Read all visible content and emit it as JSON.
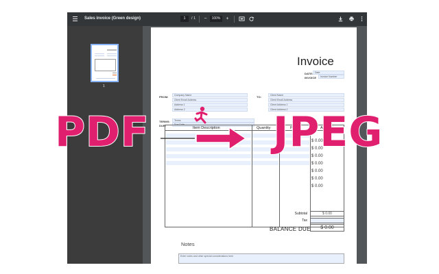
{
  "viewer": {
    "title": "Sales invoice (Green design)",
    "page_current": "1",
    "page_sep": "/",
    "page_total": "1",
    "zoom": "100%",
    "zoom_out": "−",
    "zoom_in": "+",
    "thumb_page_number": "1"
  },
  "invoice": {
    "title": "Invoice",
    "date_label": "DATE:",
    "date_value": "Date",
    "invoice_label": "INVOICE",
    "invoice_value": "Invoice Number",
    "from_label": "FROM:",
    "from_fields": [
      "Company Name",
      "Client Email Address",
      "Address 1",
      "Address 2"
    ],
    "to_label": "TO:",
    "to_fields": [
      "Client Name",
      "Client Email Address",
      "Client Address 1",
      "Client Address 2"
    ],
    "terms_label": "TERMS:",
    "terms_value": "Terms",
    "due_label": "DUE:",
    "due_value": "Due Date",
    "col_item": "Item Description",
    "col_quantity": "Quantity",
    "col_price": "Price",
    "col_amount": "Amount",
    "amounts": [
      "$ 0.00",
      "$ 0.00",
      "$ 0.00",
      "$ 0.00",
      "$ 0.00",
      "$ 0.00",
      "$ 0.00"
    ],
    "subtotal_label": "Subtotal",
    "subtotal_value": "$ 0.00",
    "tax_label": "Tax",
    "balance_label": "BALANCE DUE",
    "balance_value": "$ 0.00",
    "notes_title": "Notes",
    "notes_placeholder": "Enter notes and other special considerations here"
  },
  "overlay": {
    "left_text": "PDF",
    "right_text": "JPEG",
    "accent_color": "#e0206f"
  },
  "icons": [
    "menu-icon",
    "fit-page-icon",
    "rotate-icon",
    "download-icon",
    "print-icon",
    "more-vert-icon",
    "running-person-icon",
    "arrow-right-icon"
  ]
}
